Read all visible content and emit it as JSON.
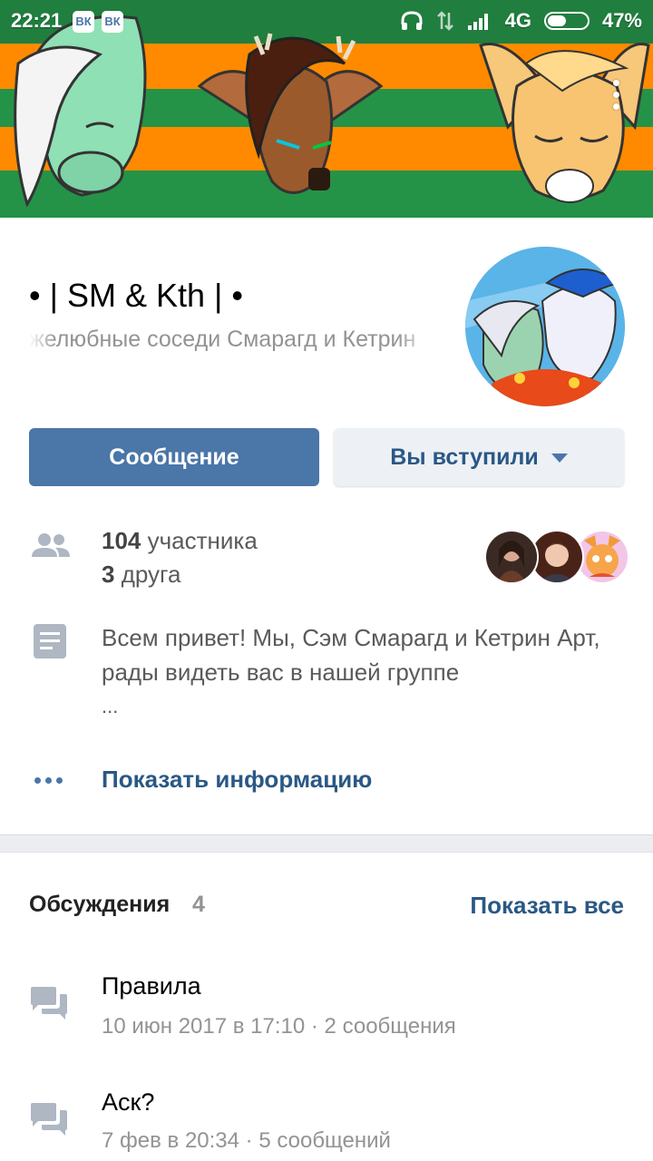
{
  "status_bar": {
    "time": "22:21",
    "vk_badge": "ВК",
    "network": "4G",
    "battery": "47%",
    "battery_level": 0.47
  },
  "group": {
    "title": "• | SM & Kth | •",
    "status": "желюбные соседи Смарагд и Кетрин"
  },
  "actions": {
    "message_label": "Сообщение",
    "joined_label": "Вы вступили"
  },
  "members": {
    "count": "104",
    "count_label": "участника",
    "friends_count": "3",
    "friends_label": "друга"
  },
  "description": {
    "text": "Всем привет! Мы, Сэм Смарагд и Кетрин Арт, рады видеть вас в нашей группе",
    "ellipsis": "..."
  },
  "info_link": "Показать информацию",
  "discussions": {
    "title": "Обсуждения",
    "count": "4",
    "show_all": "Показать все",
    "items": [
      {
        "title": "Правила",
        "meta": "10 июн 2017 в 17:10 · 2 сообщения"
      },
      {
        "title": "Аск?",
        "meta": "7 фев в 20:34 · 5 сообщений"
      }
    ]
  },
  "colors": {
    "accent": "#4a76a8",
    "link": "#2a5885",
    "cover_green": "#259347",
    "cover_orange": "#ff8a00"
  }
}
